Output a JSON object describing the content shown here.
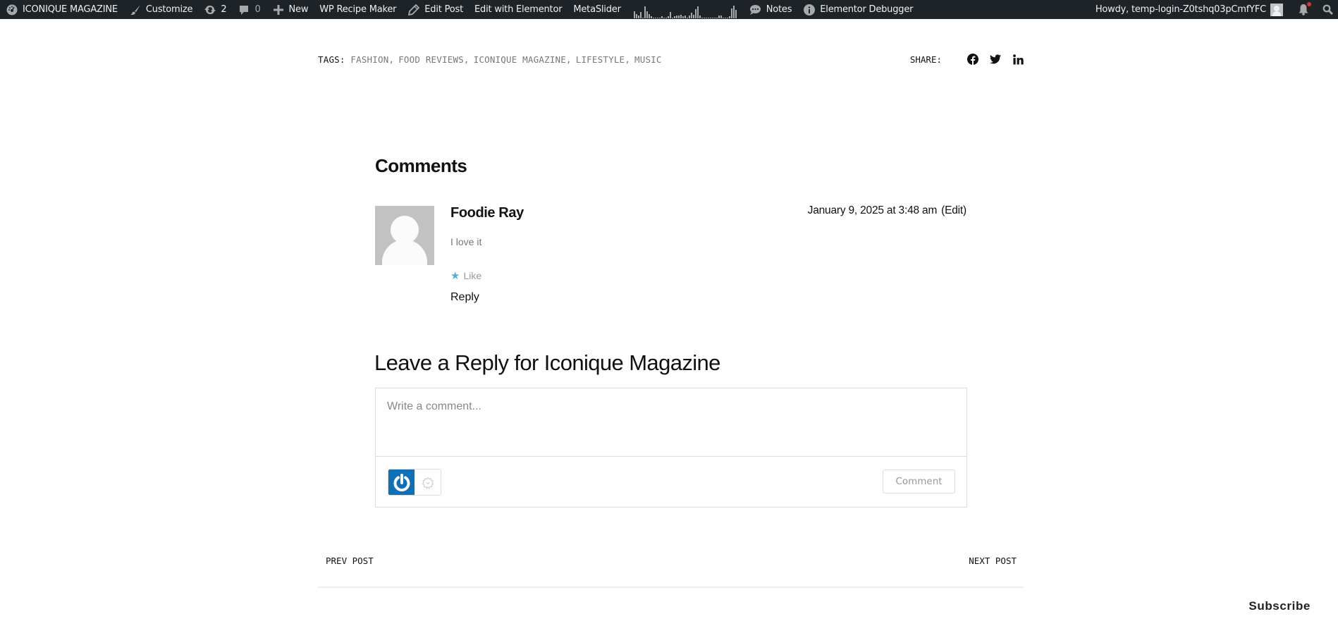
{
  "admin_bar": {
    "site_name": "ICONIQUE MAGAZINE",
    "customize": "Customize",
    "updates_count": "2",
    "comments_count": "0",
    "new": "New",
    "wp_recipe_maker": "WP Recipe Maker",
    "edit_post": "Edit Post",
    "edit_with_elementor": "Edit with Elementor",
    "metaslider": "MetaSlider",
    "notes": "Notes",
    "elementor_debugger": "Elementor Debugger",
    "howdy": "Howdy, temp-login-Z0tshq03pCmfYFC",
    "sparkline": [
      8,
      5,
      3,
      7,
      1,
      13,
      8,
      5,
      2,
      1,
      1,
      1,
      1,
      2,
      1,
      1,
      2,
      7,
      1,
      2,
      3,
      3,
      4,
      2,
      3,
      1,
      3,
      6,
      4,
      10,
      13,
      3,
      1,
      1,
      1,
      1,
      1,
      1,
      1,
      1,
      3,
      3,
      1,
      1,
      1,
      2,
      11,
      14,
      9
    ]
  },
  "tags": {
    "label": "TAGS:",
    "items": [
      "FASHION",
      "FOOD REVIEWS",
      "ICONIQUE MAGAZINE",
      "LIFESTYLE",
      "MUSIC"
    ]
  },
  "share": {
    "label": "SHARE:",
    "networks": [
      "facebook",
      "twitter",
      "linkedin"
    ]
  },
  "comments": {
    "title": "Comments",
    "items": [
      {
        "author": "Foodie Ray",
        "date": "January 9, 2025 at 3:48 am",
        "edit_label": "(Edit)",
        "text": "I love it",
        "like_label": "Like",
        "reply_label": "Reply"
      }
    ]
  },
  "reply_form": {
    "title": "Leave a Reply for Iconique Magazine",
    "placeholder": "Write a comment...",
    "value": "",
    "submit_label": "Comment"
  },
  "post_nav": {
    "prev": "PREV POST",
    "next": "NEXT POST"
  },
  "subscribe_label": "Subscribe",
  "colors": {
    "admin_bar_bg": "#1d2327",
    "wp_blue": "#0f6fb7",
    "like_star": "#4ab2dd",
    "notification_dot": "#d63638"
  }
}
